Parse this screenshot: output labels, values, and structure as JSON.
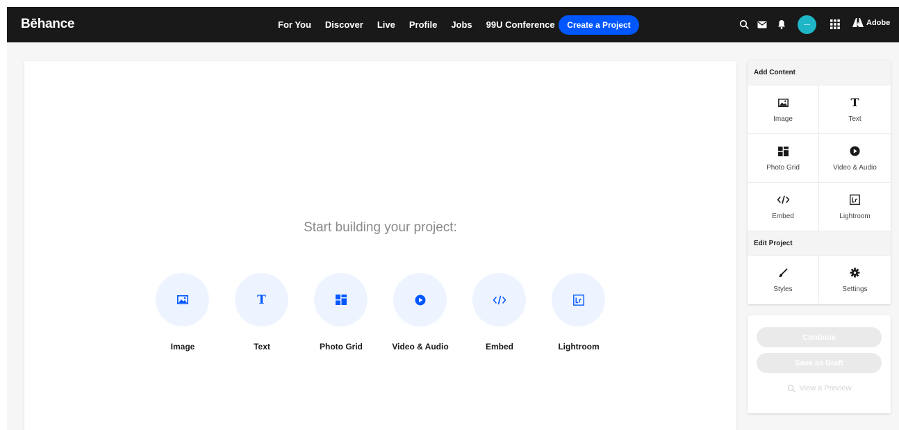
{
  "brand": {
    "logo": "Bēhance",
    "accent": "#0057ff",
    "nav_bg": "#191919"
  },
  "nav": {
    "links": [
      "For You",
      "Discover",
      "Live",
      "Profile",
      "Jobs",
      "99U Conference"
    ],
    "create_label": "Create a Project",
    "icons": [
      "search-icon",
      "mail-icon",
      "bell-icon",
      "avatar",
      "apps-grid-icon"
    ],
    "adobe_label": "Adobe"
  },
  "canvas": {
    "prompt": "Start building your project:",
    "tiles": [
      {
        "label": "Image",
        "icon": "image-icon"
      },
      {
        "label": "Text",
        "icon": "text-icon"
      },
      {
        "label": "Photo Grid",
        "icon": "photo-grid-icon"
      },
      {
        "label": "Video & Audio",
        "icon": "video-audio-icon"
      },
      {
        "label": "Embed",
        "icon": "embed-icon"
      },
      {
        "label": "Lightroom",
        "icon": "lightroom-icon"
      }
    ]
  },
  "panel": {
    "add_content_title": "Add Content",
    "add_items": [
      {
        "label": "Image",
        "icon": "image-icon"
      },
      {
        "label": "Text",
        "icon": "text-icon"
      },
      {
        "label": "Photo Grid",
        "icon": "photo-grid-icon"
      },
      {
        "label": "Video & Audio",
        "icon": "video-audio-icon"
      },
      {
        "label": "Embed",
        "icon": "embed-icon"
      },
      {
        "label": "Lightroom",
        "icon": "lightroom-icon"
      }
    ],
    "edit_project_title": "Edit Project",
    "edit_items": [
      {
        "label": "Styles",
        "icon": "brush-icon"
      },
      {
        "label": "Settings",
        "icon": "gear-icon"
      }
    ]
  },
  "actions": {
    "continue_label": "Continue",
    "save_draft_label": "Save as Draft",
    "preview_label": "View a Preview"
  }
}
